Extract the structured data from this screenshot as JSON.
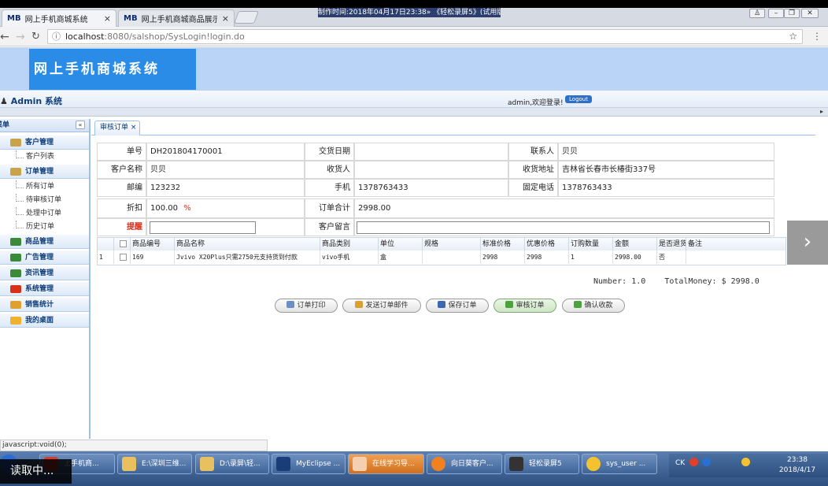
{
  "browser": {
    "tabs": [
      {
        "icon_text": "MB",
        "title": "网上手机商城系统",
        "close": "×"
      },
      {
        "icon_text": "MB",
        "title": "网上手机商城商品展示",
        "close": "×"
      }
    ],
    "recording_title": "制作时间:2018年04月17日23:38» 《轻松录屏5》(试用版)",
    "address": {
      "host": "localhost",
      "path": ":8080/salshop/SysLogin!login.do"
    },
    "status_url": "javascript:void(0);"
  },
  "app": {
    "logo_text": "网上手机商城系统",
    "system_title": "Admin 系统",
    "welcome": "admin,欢迎登录!",
    "logout_label": "Logout"
  },
  "sidebar": {
    "header": "菜单",
    "collapse": "«",
    "menus": [
      {
        "label": "客户管理",
        "subs": [
          "客户列表"
        ]
      },
      {
        "label": "订单管理",
        "subs": [
          "所有订单",
          "待审核订单",
          "处理中订单",
          "历史订单"
        ]
      },
      {
        "label": "商品管理",
        "subs": []
      },
      {
        "label": "广告管理",
        "subs": []
      },
      {
        "label": "资讯管理",
        "subs": []
      },
      {
        "label": "系统管理",
        "subs": []
      },
      {
        "label": "销售统计",
        "subs": []
      },
      {
        "label": "我的桌面",
        "subs": []
      }
    ]
  },
  "main": {
    "tab_label": "审核订单",
    "tab_close": "×",
    "form": {
      "order_no_label": "单号",
      "order_no": "DH201804170001",
      "delivery_date_label": "交货日期",
      "delivery_date": "",
      "contact_label": "联系人",
      "contact": "贝贝",
      "customer_label": "客户名称",
      "customer": "贝贝",
      "receiver_label": "收货人",
      "receiver": "",
      "address_label": "收货地址",
      "address": "吉林省长春市长椿街337号",
      "postcode_label": "邮编",
      "postcode": "123232",
      "mobile_label": "手机",
      "mobile": "1378763433",
      "phone_label": "固定电话",
      "phone": "1378763433",
      "discount_label": "折扣",
      "discount": "100.00",
      "discount_unit": "%",
      "total_label": "订单合计",
      "total": "2998.00",
      "reminder_label": "提醒",
      "reminder": "",
      "message_label": "客户留言",
      "message": ""
    },
    "grid": {
      "columns": [
        "商品编号",
        "商品名称",
        "商品类别",
        "单位",
        "规格",
        "标准价格",
        "优惠价格",
        "订购数量",
        "金额",
        "是否退货",
        "备注"
      ],
      "rows": [
        {
          "index": "1",
          "cells": [
            "169",
            "Jvivo X20Plus只需2750元支持货到付款",
            "vivo手机",
            "盒",
            "",
            "2998",
            "2998",
            "1",
            "2998.00",
            "否",
            ""
          ]
        }
      ]
    },
    "summary": {
      "number_label": "Number:",
      "number": "1.0",
      "total_label": "TotalMoney: $",
      "total": "2998.0"
    },
    "buttons": [
      "订单打印",
      "发送订单邮件",
      "保存订单",
      "审核订单",
      "确认收款"
    ]
  },
  "taskbar": {
    "items": [
      "上手机商...",
      "E:\\深圳三维...",
      "D:\\录屏\\轻...",
      "MyEclipse ...",
      "在线学习导...",
      "向日葵客户...",
      "轻松录屏5",
      "sys_user ..."
    ],
    "tray_lang": "CK",
    "time": "23:38",
    "date": "2018/4/17"
  },
  "overlay": {
    "loading": "读取中..."
  },
  "colors": {
    "header_bg": "#b9d4f6",
    "logo_bg": "#2a8ce6",
    "accent": "#0f3d78",
    "reminder_red": "#d9301a"
  }
}
